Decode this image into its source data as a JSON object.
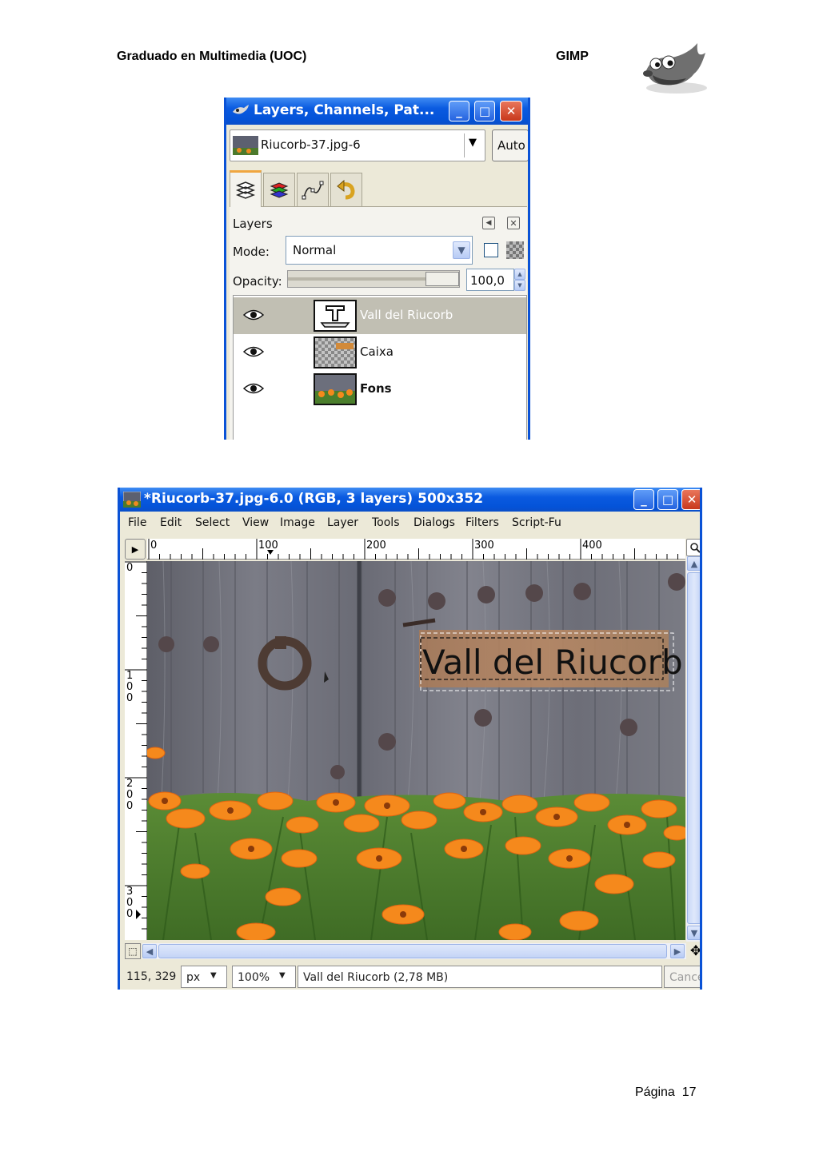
{
  "document": {
    "header_left": "Graduado en Multimedia (UOC)",
    "header_right": "GIMP",
    "footer_page": "Página  17"
  },
  "layers_dialog": {
    "title": "Layers, Channels, Pat...",
    "image_selector": "Riucorb-37.jpg-6",
    "auto_button": "Auto",
    "panel_label": "Layers",
    "mode_label": "Mode:",
    "mode_value": "Normal",
    "opacity_label": "Opacity:",
    "opacity_value": "100,0",
    "opacity_level": 1.0,
    "layers": [
      {
        "name": "Vall del Riucorb",
        "selected": true,
        "visible": true
      },
      {
        "name": "Caixa",
        "selected": false,
        "visible": true
      },
      {
        "name": "Fons",
        "selected": false,
        "visible": true
      }
    ]
  },
  "image_window": {
    "title": "*Riucorb-37.jpg-6.0 (RGB, 3 layers) 500x352",
    "menu": [
      "File",
      "Edit",
      "Select",
      "View",
      "Image",
      "Layer",
      "Tools",
      "Dialogs",
      "Filters",
      "Script-Fu"
    ],
    "ruler_h_labels": [
      "0",
      "100",
      "200",
      "300",
      "400"
    ],
    "ruler_v_labels": [
      "0",
      "100",
      "200",
      "300"
    ],
    "canvas_text": "Vall del Riucorb",
    "status": {
      "coords": "115, 329",
      "unit": "px",
      "zoom": "100%",
      "message": "Vall del Riucorb (2,78 MB)",
      "cancel": "Cancel"
    }
  },
  "colors": {
    "xp_title_blue": "#0a5ae0",
    "dialog_bg": "#ece9d8",
    "selected_row": "#c1bfb3",
    "flower_orange": "#f5891c",
    "wood_gray": "#747680"
  }
}
